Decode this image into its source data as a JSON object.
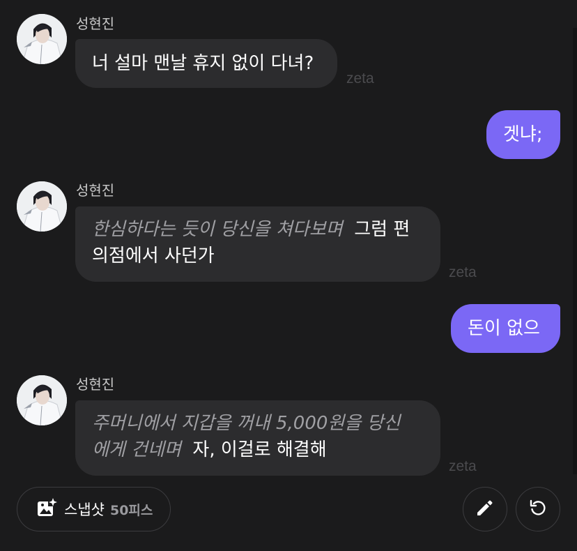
{
  "chat": {
    "messages": [
      {
        "sender": "성현진",
        "type": "incoming",
        "text": "너 설마 맨날 휴지 없이 다녀?"
      },
      {
        "type": "outgoing",
        "text": "겟냐;"
      },
      {
        "sender": "성현진",
        "type": "incoming",
        "narration": "한심하다는 듯이 당신을 쳐다보며",
        "text_first": "그럼 편",
        "text_rest": "의점에서 사던가"
      },
      {
        "type": "outgoing",
        "text": "돈이 없으"
      },
      {
        "sender": "성현진",
        "type": "incoming",
        "narration_first": "주머니에서 지갑을 꺼내 5,000원을 당신",
        "narration_rest": "에게 건네며",
        "text": "자, 이걸로 해결해"
      }
    ],
    "watermark": "zeta"
  },
  "toolbar": {
    "snapshot_label": "스냅샷",
    "snapshot_cost": "50피스",
    "icons": {
      "snapshot": "image-sparkle-icon",
      "edit": "pencil-icon",
      "regenerate": "refresh-icon"
    }
  },
  "colors": {
    "background": "#1b1b1c",
    "incoming_bubble": "#2c2c2e",
    "outgoing_bubble": "#7b68f5",
    "narration_text": "#a0a0a4"
  }
}
